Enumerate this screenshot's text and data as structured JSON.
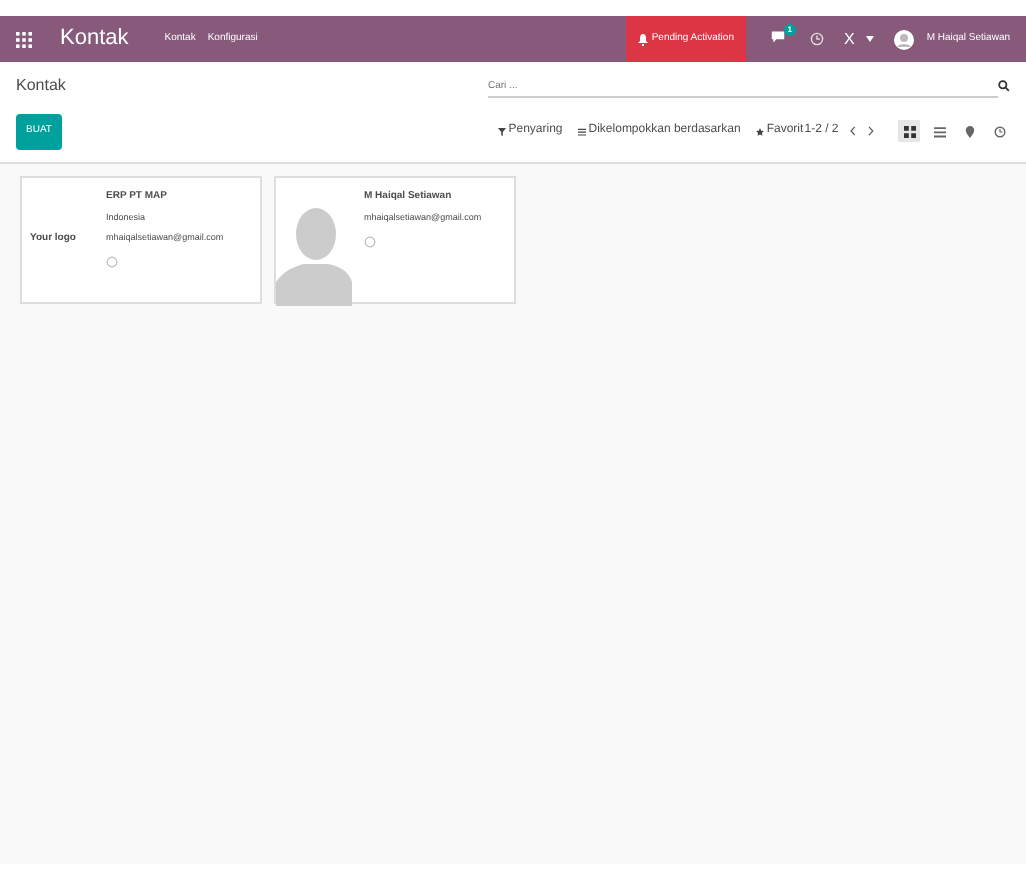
{
  "navbar": {
    "app_title": "Kontak",
    "menu": [
      "Kontak",
      "Konfigurasi"
    ],
    "pending": "Pending Activation",
    "chat_badge": "1",
    "company": "X",
    "user": "M Haiqal Setiawan"
  },
  "breadcrumb": "Kontak",
  "create_button": "BUAT",
  "search": {
    "placeholder": "Cari ..."
  },
  "filters": [
    "Penyaring",
    "Dikelompokkan berdasarkan",
    "Favorit"
  ],
  "pager": "1-2 / 2",
  "views": [
    {
      "kind": "kanban",
      "selected": true
    },
    {
      "kind": "list",
      "selected": false
    },
    {
      "kind": "map",
      "selected": false
    },
    {
      "kind": "activity",
      "selected": false
    }
  ],
  "cards": [
    {
      "kind": "logo",
      "logo_text": "Your logo",
      "name": "ERP PT MAP",
      "lines": [
        "Indonesia",
        "mhaiqalsetiawan@gmail.com"
      ]
    },
    {
      "kind": "person",
      "name": "M Haiqal Setiawan",
      "lines": [
        "mhaiqalsetiawan@gmail.com"
      ]
    }
  ]
}
